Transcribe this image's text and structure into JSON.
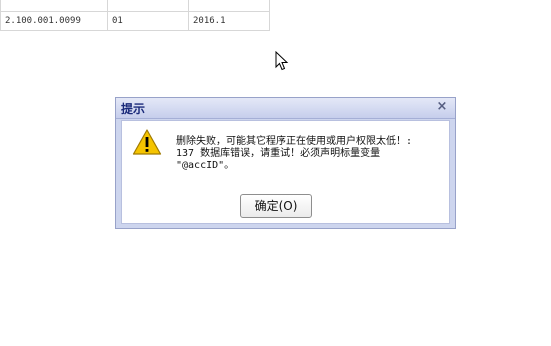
{
  "background_table": {
    "row": {
      "col1": "2.100.001.0099",
      "col2": "01",
      "col3": "2016.1"
    }
  },
  "dialog": {
    "title": "提示",
    "close_label": "×",
    "icon": "warning-icon",
    "message": "删除失败，可能其它程序正在使用或用户权限太低！:\n137 数据库错误，请重试！必须声明标量变量\n\"@accID\"。",
    "ok_label": "确定(O)"
  },
  "colors": {
    "titlebar": "#c6ceec",
    "warning": "#f5c400"
  }
}
